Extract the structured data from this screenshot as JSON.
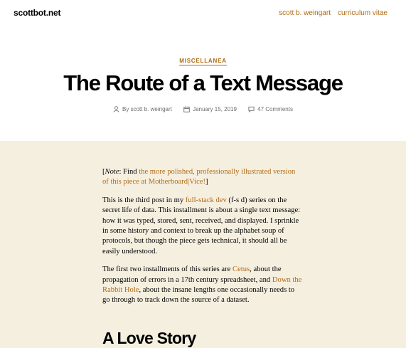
{
  "header": {
    "site_title": "scottbot.net",
    "nav": [
      "scott b. weingart",
      "curriculum vitae"
    ]
  },
  "post": {
    "category": "MISCELLANEA",
    "title": "The Route of a Text Message",
    "meta": {
      "author_prefix": "By",
      "author": "scott b. weingart",
      "date": "January 15, 2019",
      "comments": "47 Comments"
    }
  },
  "content": {
    "p1": {
      "open": "[",
      "note": "Note",
      "mid": ": Find ",
      "link": "the more polished, professionally illustrated version of this piece at Motherboard|Vice!",
      "close": "]"
    },
    "p2": {
      "a": "This is the third post in my ",
      "link": "full-stack dev",
      "b": " (f-s d) series on the secret life of data. This installment is about a single text message: how it was typed, stored, sent, received, and displayed. I sprinkle in some history and context to break up the alphabet soup of protocols, but though the piece gets technical, it should all be easily understood."
    },
    "p3": {
      "a": "The first two installments of this series are ",
      "link1": "Cetus",
      "b": ", about the propagation of errors in a 17th century spreadsheet, and ",
      "link2": "Down the Rabbit Hole",
      "c": ", about the insane lengths one occasionally needs to go through to track down the source of a dataset."
    },
    "heading": "A Love Story"
  },
  "colors": {
    "accent": "#b06a14",
    "content_bg": "#f5efe0",
    "header_bg": "#ffffff"
  }
}
